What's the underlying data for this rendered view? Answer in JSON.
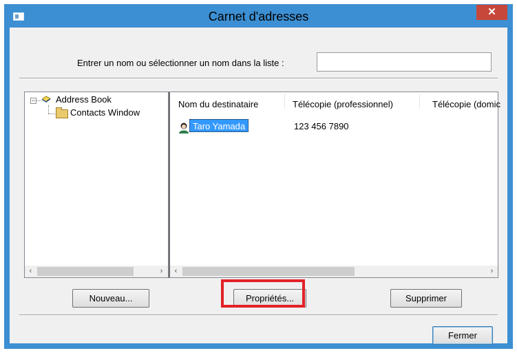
{
  "window": {
    "title": "Carnet d'adresses",
    "close_glyph": "✕"
  },
  "search": {
    "label": "Entrer un nom ou sélectionner un nom dans la liste :",
    "value": "",
    "placeholder": ""
  },
  "tree": {
    "expander_glyph": "−",
    "root_label": "Address Book",
    "child_label": "Contacts Window",
    "icons": {
      "root": "address-book-icon",
      "child": "folder-icon"
    }
  },
  "list": {
    "columns": [
      "Nom du destinataire",
      "Télécopie (professionnel)",
      "Télécopie (domic"
    ],
    "rows": [
      {
        "name": "Taro Yamada",
        "fax_business": "123 456 7890",
        "fax_home": "",
        "icon": "contact-icon"
      }
    ],
    "selection_color": "#3399ff"
  },
  "scrollbars": {
    "left_arrow": "‹",
    "right_arrow": "›"
  },
  "buttons": {
    "new": "Nouveau...",
    "properties": "Propriétés...",
    "delete": "Supprimer",
    "close": "Fermer"
  },
  "colors": {
    "title_bar": "#3c8fd3",
    "close_button": "#c7473a",
    "highlight_border": "#e32127",
    "dialog_background": "#f0f0f0"
  }
}
